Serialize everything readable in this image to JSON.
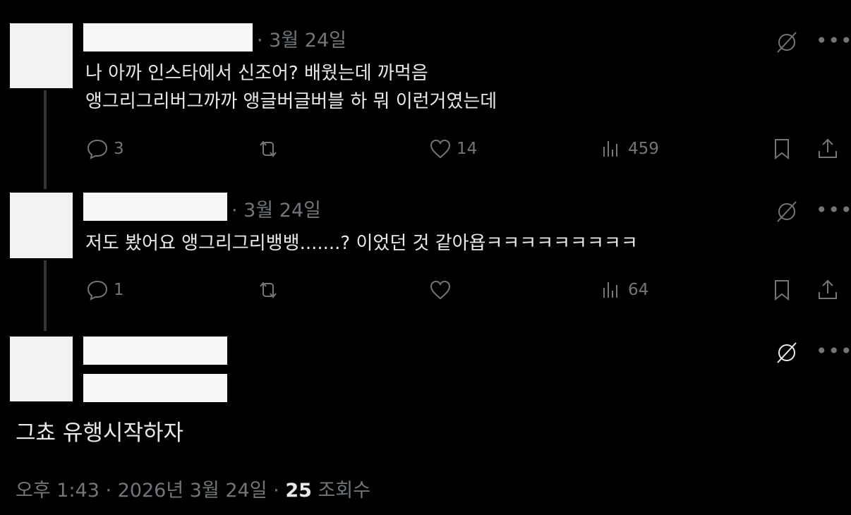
{
  "replies": [
    {
      "date": "· 3월 24일",
      "text_lines": [
        "나 아까 인스타에서 신조어? 배웠는데 까먹음",
        "앵그리그리버그까까 앵글버글버블 하 뭐 이런거였는데"
      ],
      "replies_count": "3",
      "likes_count": "14",
      "views_count": "459"
    },
    {
      "date": "· 3월 24일",
      "text_lines": [
        "저도 봤어요 앵그리그리뱅뱅.......? 이었던 것 같아욥ㅋㅋㅋㅋㅋㅋㅋㅋㅋ"
      ],
      "replies_count": "1",
      "likes_count": "",
      "views_count": "64"
    }
  ],
  "main_post": {
    "text": "그쵸 유행시작하자",
    "time": "오후 1:43 · 2026년 3월 24일 · ",
    "views_count": "25",
    "views_label": " 조회수"
  },
  "icons": {
    "grok": "grok-slash-icon",
    "more": "more-icon",
    "reply": "reply-icon",
    "retweet": "retweet-icon",
    "like": "heart-icon",
    "views": "views-icon",
    "bookmark": "bookmark-icon",
    "share": "share-icon"
  },
  "colors": {
    "background": "#000000",
    "text": "#e7e9ea",
    "secondary": "#71767b",
    "thread_line": "#333639"
  }
}
